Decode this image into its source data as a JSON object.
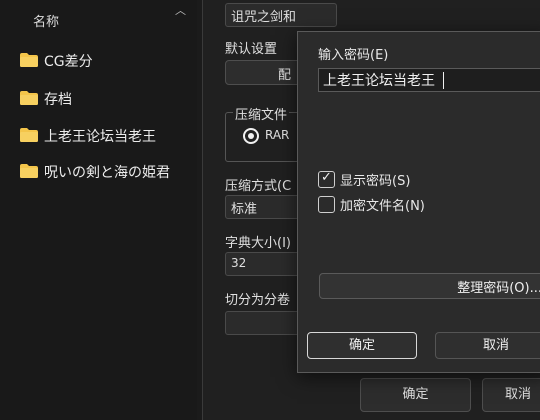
{
  "explorer": {
    "column_header": "名称",
    "folders": [
      {
        "label": "CG差分"
      },
      {
        "label": "存档"
      },
      {
        "label": "上老王论坛当老王"
      },
      {
        "label": "呪いの剣と海の姫君"
      }
    ]
  },
  "archive_dialog": {
    "archive_name": "诅咒之剑和",
    "default_settings_label": "默认设置",
    "profile_button": "配",
    "format_group": "压缩文件",
    "format_rar": "RAR",
    "compression_method_label": "压缩方式(C",
    "compression_method_value": "标准",
    "dictionary_size_label": "字典大小(I)",
    "dictionary_size_value": "32",
    "split_volumes_label": "切分为分卷",
    "ok_button": "确定",
    "cancel_button": "取消"
  },
  "password_dialog": {
    "input_label": "输入密码(E)",
    "password_value": "上老王论坛当老王",
    "show_password": {
      "label": "显示密码(S)",
      "checked": true
    },
    "encrypt_filenames": {
      "label": "加密文件名(N)",
      "checked": false
    },
    "organize_button": "整理密码(O)...",
    "ok_button": "确定",
    "cancel_button": "取消"
  },
  "colors": {
    "folder": "#f4c54a",
    "background": "#1b1b1b"
  }
}
